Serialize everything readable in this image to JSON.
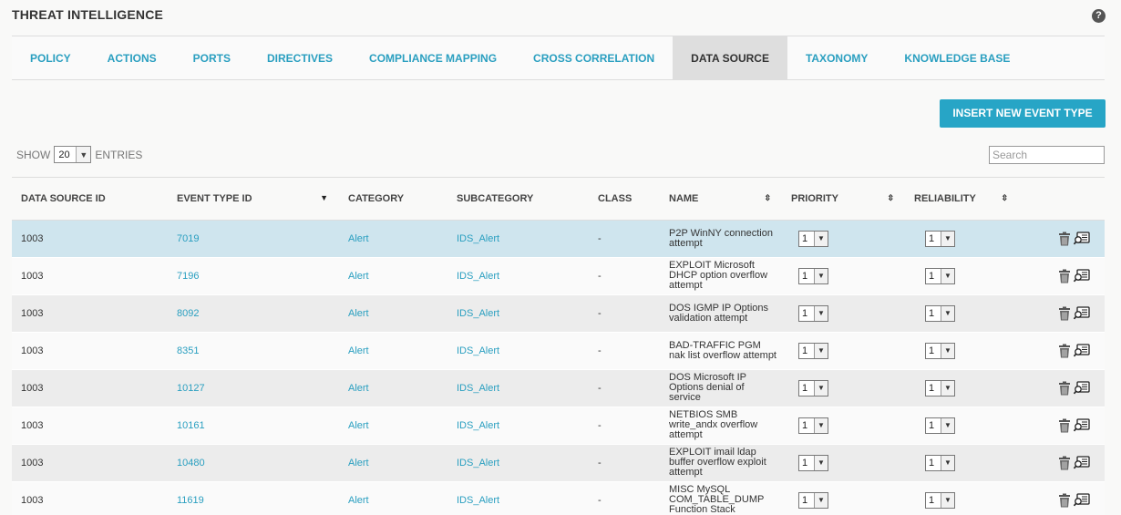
{
  "app": {
    "title": "THREAT INTELLIGENCE",
    "help": "?"
  },
  "tabs": [
    {
      "label": "POLICY",
      "active": false
    },
    {
      "label": "ACTIONS",
      "active": false
    },
    {
      "label": "PORTS",
      "active": false
    },
    {
      "label": "DIRECTIVES",
      "active": false
    },
    {
      "label": "COMPLIANCE MAPPING",
      "active": false
    },
    {
      "label": "CROSS CORRELATION",
      "active": false
    },
    {
      "label": "DATA SOURCE",
      "active": true
    },
    {
      "label": "TAXONOMY",
      "active": false
    },
    {
      "label": "KNOWLEDGE BASE",
      "active": false
    }
  ],
  "toolbar": {
    "insert_label": "INSERT NEW EVENT TYPE",
    "show_label": "SHOW",
    "entries_value": "20",
    "entries_label": "ENTRIES",
    "search_placeholder": "Search"
  },
  "table": {
    "headers": [
      {
        "label": "DATA SOURCE ID",
        "sort": ""
      },
      {
        "label": "EVENT TYPE ID",
        "sort": "▼"
      },
      {
        "label": "CATEGORY",
        "sort": ""
      },
      {
        "label": "SUBCATEGORY",
        "sort": ""
      },
      {
        "label": "CLASS",
        "sort": ""
      },
      {
        "label": "NAME",
        "sort": "⇳"
      },
      {
        "label": "PRIORITY",
        "sort": "⇳"
      },
      {
        "label": "RELIABILITY",
        "sort": "⇳"
      }
    ],
    "rows": [
      {
        "ds_id": "1003",
        "event_id": "7019",
        "category": "Alert",
        "subcategory": "IDS_Alert",
        "class": "-",
        "name": "P2P WinNY connection attempt",
        "priority": "1",
        "reliability": "1",
        "selected": true
      },
      {
        "ds_id": "1003",
        "event_id": "7196",
        "category": "Alert",
        "subcategory": "IDS_Alert",
        "class": "-",
        "name": "EXPLOIT Microsoft DHCP option overflow attempt",
        "priority": "1",
        "reliability": "1",
        "selected": false
      },
      {
        "ds_id": "1003",
        "event_id": "8092",
        "category": "Alert",
        "subcategory": "IDS_Alert",
        "class": "-",
        "name": "DOS IGMP IP Options validation attempt",
        "priority": "1",
        "reliability": "1",
        "selected": false
      },
      {
        "ds_id": "1003",
        "event_id": "8351",
        "category": "Alert",
        "subcategory": "IDS_Alert",
        "class": "-",
        "name": "BAD-TRAFFIC PGM nak list overflow attempt",
        "priority": "1",
        "reliability": "1",
        "selected": false
      },
      {
        "ds_id": "1003",
        "event_id": "10127",
        "category": "Alert",
        "subcategory": "IDS_Alert",
        "class": "-",
        "name": "DOS Microsoft IP Options denial of service",
        "priority": "1",
        "reliability": "1",
        "selected": false
      },
      {
        "ds_id": "1003",
        "event_id": "10161",
        "category": "Alert",
        "subcategory": "IDS_Alert",
        "class": "-",
        "name": "NETBIOS SMB write_andx overflow attempt",
        "priority": "1",
        "reliability": "1",
        "selected": false
      },
      {
        "ds_id": "1003",
        "event_id": "10480",
        "category": "Alert",
        "subcategory": "IDS_Alert",
        "class": "-",
        "name": "EXPLOIT imail ldap buffer overflow exploit attempt",
        "priority": "1",
        "reliability": "1",
        "selected": false
      },
      {
        "ds_id": "1003",
        "event_id": "11619",
        "category": "Alert",
        "subcategory": "IDS_Alert",
        "class": "-",
        "name": "MISC MySQL COM_TABLE_DUMP Function Stack",
        "priority": "1",
        "reliability": "1",
        "selected": false
      }
    ],
    "row_icons": [
      "trash-icon",
      "edit-icon"
    ]
  }
}
